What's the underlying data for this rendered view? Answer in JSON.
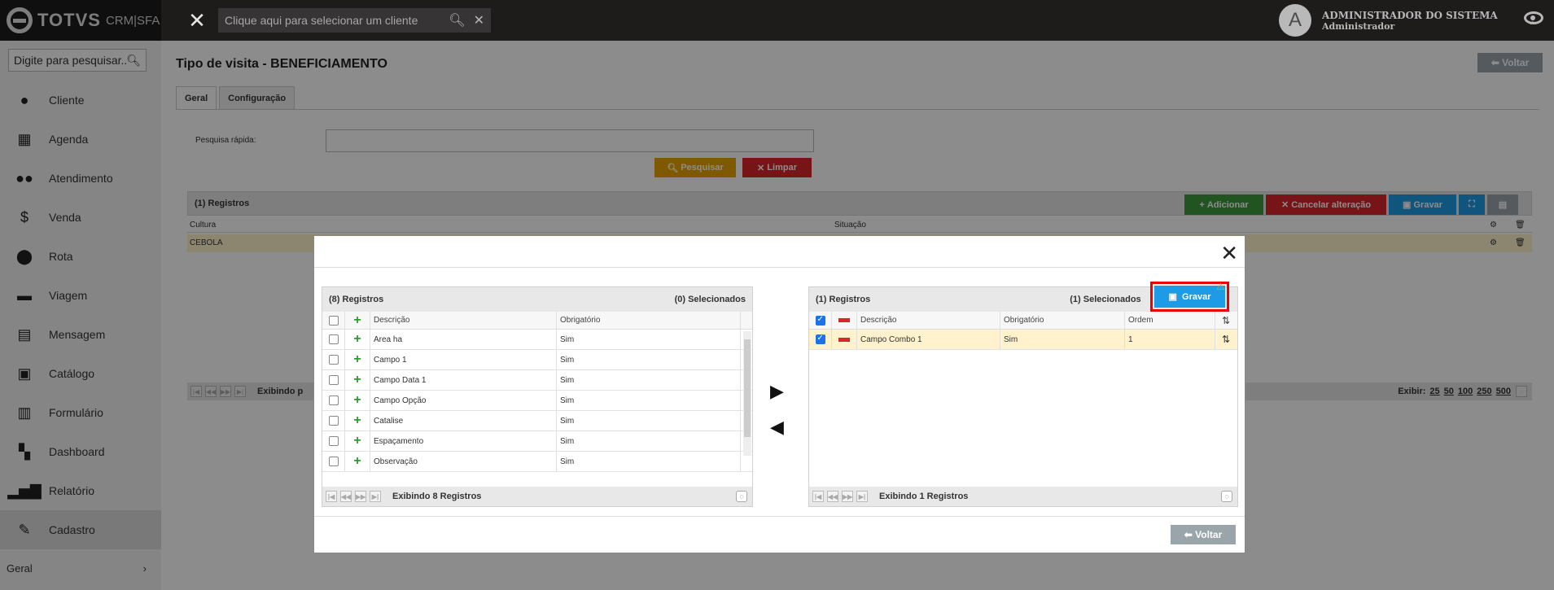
{
  "topbar": {
    "brand": "TOTVS",
    "product": "CRM|SFA",
    "search_placeholder": "Clique aqui para selecionar um cliente",
    "user_initial": "A",
    "user_name": "ADMINISTRADOR DO SISTEMA",
    "user_role": "Administrador"
  },
  "sidebar": {
    "search_placeholder": "Digite para pesquisar...",
    "items": [
      {
        "label": "Cliente",
        "icon": "person-icon"
      },
      {
        "label": "Agenda",
        "icon": "calendar-icon"
      },
      {
        "label": "Atendimento",
        "icon": "people-icon"
      },
      {
        "label": "Venda",
        "icon": "dollar-icon"
      },
      {
        "label": "Rota",
        "icon": "pin-icon"
      },
      {
        "label": "Viagem",
        "icon": "car-icon"
      },
      {
        "label": "Mensagem",
        "icon": "message-icon"
      },
      {
        "label": "Catálogo",
        "icon": "image-icon"
      },
      {
        "label": "Formulário",
        "icon": "clipboard-icon"
      },
      {
        "label": "Dashboard",
        "icon": "dashboard-icon"
      },
      {
        "label": "Relatório",
        "icon": "bar-chart-icon"
      },
      {
        "label": "Cadastro",
        "icon": "pencil-icon"
      }
    ],
    "footer": "Geral"
  },
  "page": {
    "title": "Tipo de visita - BENEFICIAMENTO",
    "back_label": "Voltar",
    "tabs": [
      "Geral",
      "Configuração"
    ],
    "quick_search_label": "Pesquisa rápida:",
    "search_btn": "Pesquisar",
    "clear_btn": "Limpar",
    "grid_count": "(1) Registros",
    "add_btn": "Adicionar",
    "cancel_btn": "Cancelar alteração",
    "save_btn": "Gravar",
    "col_cultura": "Cultura",
    "col_situacao": "Situação",
    "row_cultura": "CEBOLA",
    "pager_text": "Exibindo p",
    "show_label": "Exibir:",
    "show_options": [
      "25",
      "50",
      "100",
      "250",
      "500"
    ]
  },
  "modal": {
    "left": {
      "count": "(8) Registros",
      "selected": "(0) Selecionados",
      "col_desc": "Descrição",
      "col_obrig": "Obrigatório",
      "rows": [
        {
          "desc": "Area ha",
          "obrig": "Sim"
        },
        {
          "desc": "Campo 1",
          "obrig": "Sim"
        },
        {
          "desc": "Campo Data 1",
          "obrig": "Sim"
        },
        {
          "desc": "Campo Opção",
          "obrig": "Sim"
        },
        {
          "desc": "Catalise",
          "obrig": "Sim"
        },
        {
          "desc": "Espaçamento",
          "obrig": "Sim"
        },
        {
          "desc": "Observação",
          "obrig": "Sim"
        }
      ],
      "footer": "Exibindo 8 Registros"
    },
    "right": {
      "count": "(1) Registros",
      "selected": "(1) Selecionados",
      "save": "Gravar",
      "col_desc": "Descrição",
      "col_obrig": "Obrigatório",
      "col_ordem": "Ordem",
      "rows": [
        {
          "desc": "Campo Combo 1",
          "obrig": "Sim",
          "ordem": "1"
        }
      ],
      "footer": "Exibindo 1 Registros"
    },
    "back": "Voltar"
  }
}
